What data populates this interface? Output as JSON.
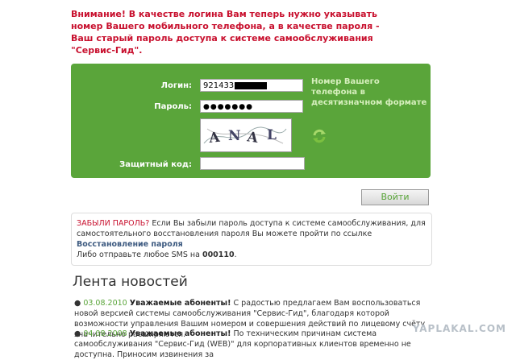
{
  "warning": "Внимание! В качестве логина Вам теперь нужно указывать номер Вашего мобильного телефона, а в качестве пароля - Ваш старый пароль доступа к системе самообслуживания \"Сервис-Гид\".",
  "login": {
    "login_label": "Логин:",
    "login_value": "921433",
    "password_label": "Пароль:",
    "password_value": "●●●●●●●",
    "hint": "Номер Вашего телефона в десятизначном формате",
    "captcha_text": "ANAL",
    "code_label": "Защитный код:",
    "code_value": ""
  },
  "submit_label": "Войти",
  "forgot": {
    "title": "ЗАБЫЛИ ПАРОЛЬ?",
    "text": " Если Вы забыли пароль доступа к системе самообслуживания, для самостоятельного восстановления пароля Вы можете пройти по ссылке ",
    "link": "Восстановление пароля",
    "sms_text": "Либо отправьте любое SMS на ",
    "sms_number": "000110",
    "sms_end": "."
  },
  "news_title": "Лента новостей",
  "news": [
    {
      "date": "03.08.2010",
      "heading": "Уважаемые абоненты!",
      "text": " С радостью предлагаем Вам воспользоваться новой версией системы самообслуживания \"Сервис-Гид\", благодаря которой возможности управления Вашим номером и совершения действий по лицевому счёту значительно расширяются."
    },
    {
      "date": "04.08.2008",
      "heading": "Уважаемые абоненты!",
      "text": " По техническим причинам система самообслуживания \"Сервис-Гид (WEB)\" для корпоративных клиентов временно не доступна. Приносим извинения за"
    }
  ],
  "watermark": "YAPLAKAL.COM"
}
